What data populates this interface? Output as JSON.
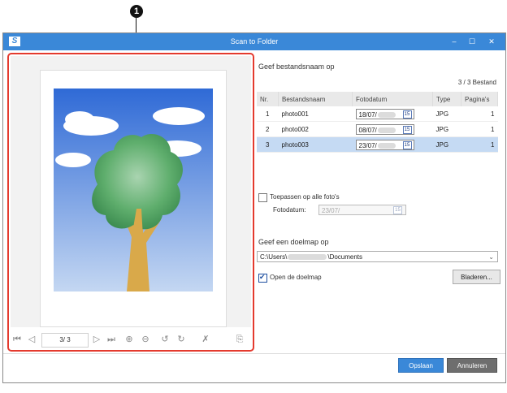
{
  "callout": {
    "number": "1"
  },
  "window": {
    "title": "Scan to Folder",
    "app_icon": "S",
    "controls": {
      "minimize": "‒",
      "maximize": "☐",
      "close": "✕"
    }
  },
  "preview": {
    "page_counter": "3/ 3"
  },
  "filename_section": {
    "heading": "Geef bestandsnaam op",
    "counter": "3 /    3 Bestand",
    "columns": [
      "Nr.",
      "Bestandsnaam",
      "Fotodatum",
      "Type",
      "Pagina's"
    ],
    "rows": [
      {
        "nr": "1",
        "name": "photo001",
        "date": "18/07/",
        "type": "JPG",
        "pages": "1"
      },
      {
        "nr": "2",
        "name": "photo002",
        "date": "08/07/",
        "type": "JPG",
        "pages": "1"
      },
      {
        "nr": "3",
        "name": "photo003",
        "date": "23/07/",
        "type": "JPG",
        "pages": "1"
      }
    ],
    "calendar_label": "15",
    "apply_all_label": "Toepassen op alle foto's",
    "fotodatum_label": "Fotodatum:",
    "fotodatum_value": "23/07/"
  },
  "folder_section": {
    "heading": "Geef een doelmap op",
    "path_prefix": "C:\\Users\\",
    "path_suffix": "\\Documents",
    "open_folder_label": "Open de doelmap",
    "open_folder_checked": true,
    "browse_label": "Bladeren..."
  },
  "footer": {
    "save_label": "Opslaan",
    "cancel_label": "Annuleren"
  },
  "colors": {
    "titlebar": "#3a88d8",
    "highlight_border": "#e43a2e",
    "selected_row": "#c5daf3"
  }
}
